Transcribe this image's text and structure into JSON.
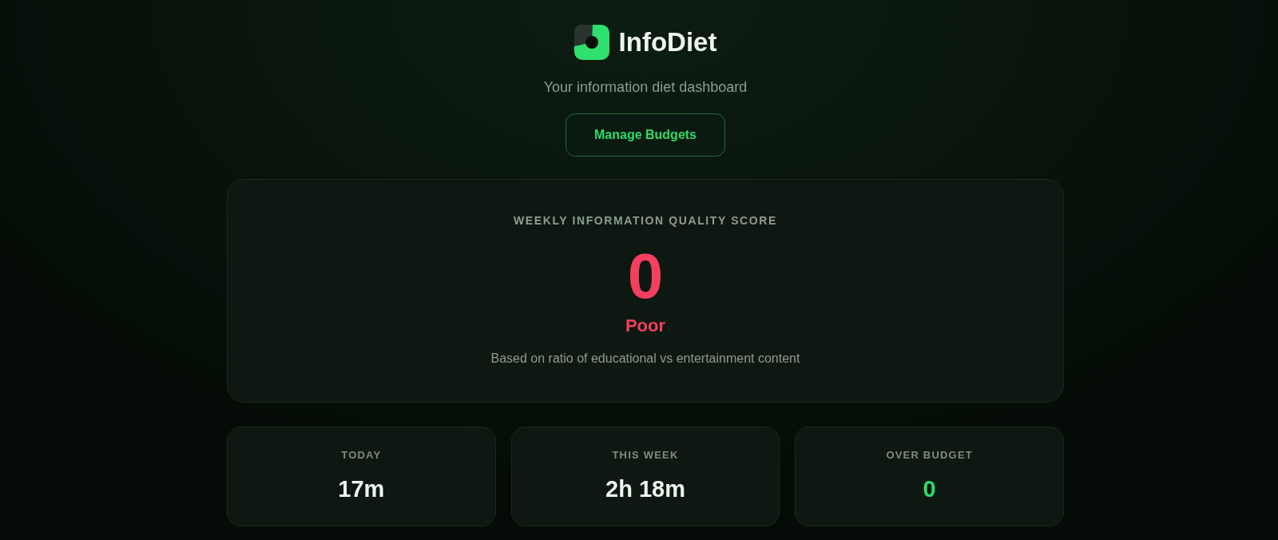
{
  "header": {
    "title": "InfoDiet",
    "subtitle": "Your information diet dashboard",
    "button": "Manage Budgets"
  },
  "score_card": {
    "title": "WEEKLY INFORMATION QUALITY SCORE",
    "score": "0",
    "rating": "Poor",
    "color": "#f43f5e",
    "description": "Based on ratio of educational vs entertainment content"
  },
  "stats": [
    {
      "label": "TODAY",
      "value": "17m",
      "color": "#eef3ef"
    },
    {
      "label": "THIS WEEK",
      "value": "2h 18m",
      "color": "#eef3ef"
    },
    {
      "label": "OVER BUDGET",
      "value": "0",
      "color": "#2bdc68"
    }
  ]
}
